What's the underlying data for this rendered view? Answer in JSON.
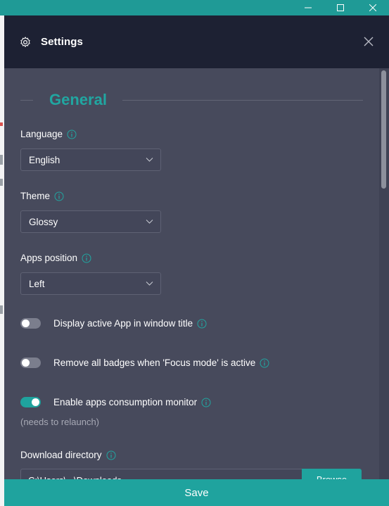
{
  "window": {
    "controls": [
      "minimize-icon",
      "maximize-icon",
      "close-icon"
    ]
  },
  "modal": {
    "title": "Settings",
    "header_icon": "gear-icon",
    "close_icon": "close-icon"
  },
  "section": {
    "title": "General"
  },
  "fields": {
    "language": {
      "label": "Language",
      "value": "English"
    },
    "theme": {
      "label": "Theme",
      "value": "Glossy"
    },
    "apps_position": {
      "label": "Apps position",
      "value": "Left"
    },
    "download_directory": {
      "label": "Download directory",
      "value": "C:\\Users\\...\\Downloads",
      "browse_label": "Browse"
    }
  },
  "toggles": [
    {
      "label": "Display active App in window title",
      "on": false
    },
    {
      "label": "Remove all badges when 'Focus mode' is active",
      "on": false
    },
    {
      "label": "Enable apps consumption monitor",
      "on": true
    }
  ],
  "notes": {
    "relaunch": "(needs to relaunch)"
  },
  "footer": {
    "save_label": "Save"
  },
  "colors": {
    "accent": "#1fa39e",
    "header": "#1d2133",
    "panel": "#474a5c"
  }
}
